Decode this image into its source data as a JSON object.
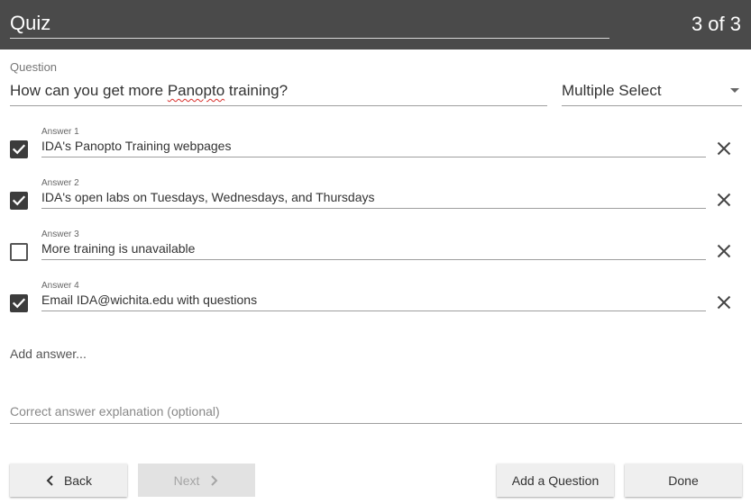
{
  "header": {
    "title": "Quiz",
    "counter": "3 of 3"
  },
  "question": {
    "label": "Question",
    "text_before": "How can you get more ",
    "text_misspelled": "Panopto",
    "text_after": " training?",
    "type": "Multiple Select"
  },
  "answers": [
    {
      "label": "Answer 1",
      "text": "IDA's Panopto Training webpages",
      "checked": true
    },
    {
      "label": "Answer 2",
      "text": "IDA's open labs on Tuesdays, Wednesdays, and Thursdays",
      "checked": true
    },
    {
      "label": "Answer 3",
      "text": "More training is unavailable",
      "checked": false
    },
    {
      "label": "Answer 4",
      "text": "Email IDA@wichita.edu with questions",
      "checked": true
    }
  ],
  "add_answer": "Add answer...",
  "explanation": {
    "placeholder": "Correct answer explanation (optional)"
  },
  "buttons": {
    "back": "Back",
    "next": "Next",
    "add_question": "Add a Question",
    "done": "Done"
  },
  "icons": {
    "checkbox_check": "check-icon",
    "remove_answer": "close-icon",
    "back": "chevron-left-icon",
    "next": "chevron-right-icon",
    "type_dropdown": "caret-down-icon"
  },
  "colors": {
    "header_bg": "#4a4a4a",
    "button_bg": "#efefef",
    "checkbox_checked": "#3c3c3c"
  }
}
